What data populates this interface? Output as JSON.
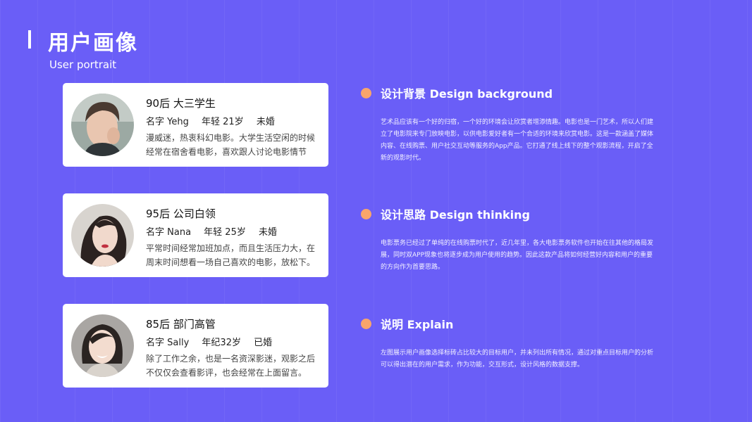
{
  "header": {
    "title": "用户画像",
    "subtitle": "User portrait"
  },
  "colors": {
    "background": "#6a5ef7",
    "accent_dot": "#f9a56b",
    "card": "#ffffff"
  },
  "personas": [
    {
      "title": "90后 大三学生",
      "name": "名字 Yehg",
      "age": "年轻 21岁",
      "status": "未婚",
      "desc": [
        "漫威迷，热衷科幻电影。大学生活空闲的时候",
        "经常在宿舍看电影，喜欢跟人讨论电影情节"
      ]
    },
    {
      "title": "95后 公司白领",
      "name": "名字 Nana",
      "age": "年轻 25岁",
      "status": "未婚",
      "desc": [
        "平常时间经常加班加点，而且生活压力大，在",
        "周末时间想看一场自己喜欢的电影，放松下。"
      ]
    },
    {
      "title": "85后 部门高管",
      "name": "名字 Sally",
      "age": "年纪32岁",
      "status": "已婚",
      "desc": [
        "除了工作之余，也是一名资深影迷，观影之后",
        "不仅仅会查看影评，也会经常在上面留言。"
      ]
    }
  ],
  "sections": [
    {
      "title": "设计背景 Design background",
      "lines": [
        "艺术品应该有一个好的归宿，一个好的环境会让欣赏者增添情趣。电影也是一门艺术，所以人们建",
        "立了电影院来专门放映电影，以供电影爱好者有一个合适的环境来欣赏电影。这是一款涵盖了媒体",
        "内容、在线购票、用户社交互动等服务的App产品。它打通了线上线下的整个观影流程，开启了全",
        "新的观影时代。"
      ]
    },
    {
      "title": "设计思路 Design thinking",
      "lines": [
        "电影票务已经过了单纯的在线购票时代了，近几年里，各大电影票务软件也开始在往其他的格局发",
        "展，同时双APP现象也将逐步成为用户使用的趋势。因此这款产品将如何经营好内容和用户的重要",
        "的方向作为首要思路。"
      ]
    },
    {
      "title": "说明 Explain",
      "lines": [
        "左图展示用户画像选择标砖占比较大的目标用户，并未列出所有情况，通过对重点目标用户的分析",
        "可以得出潜在的用户需求，作为功能，交互形式，设计风格的数据支撑。"
      ]
    }
  ]
}
